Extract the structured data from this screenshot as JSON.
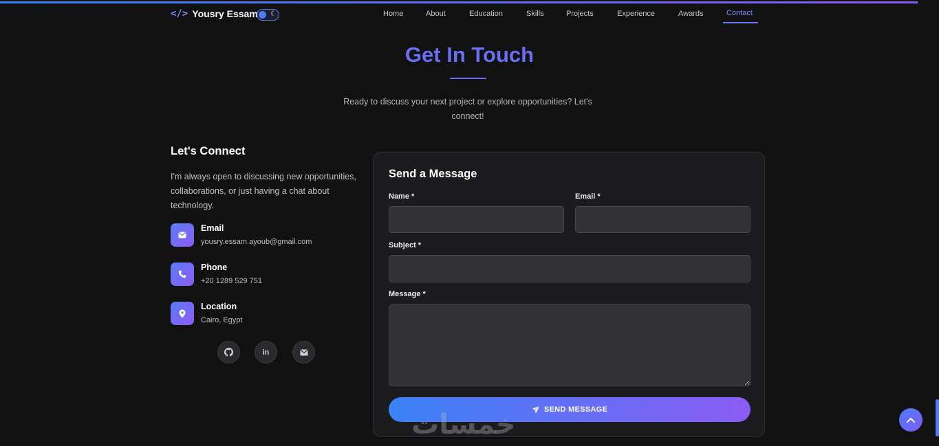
{
  "nav": {
    "brand_code": "</>",
    "brand_name": "Yousry Essam",
    "theme_toggle_moon": "☾",
    "links": [
      "Home",
      "About",
      "Education",
      "Skills",
      "Projects",
      "Experience",
      "Awards",
      "Contact"
    ],
    "active": "Contact"
  },
  "hero": {
    "title": "Get In Touch",
    "subtitle": "Ready to discuss your next project or explore opportunities? Let's connect!"
  },
  "connect": {
    "title": "Let's Connect",
    "text": "I'm always open to discussing new opportunities, collaborations, or just having a chat about technology.",
    "items": [
      {
        "label": "Email",
        "value": "yousry.essam.ayoub@gmail.com",
        "icon": "envelope-icon"
      },
      {
        "label": "Phone",
        "value": "+20 1289 529 751",
        "icon": "phone-icon"
      },
      {
        "label": "Location",
        "value": "Cairo, Egypt",
        "icon": "map-pin-icon"
      }
    ],
    "socials": [
      {
        "icon": "github-icon"
      },
      {
        "icon": "linkedin-icon",
        "glyph": "in"
      },
      {
        "icon": "envelope-icon"
      }
    ]
  },
  "form": {
    "title": "Send a Message",
    "name_label": "Name *",
    "email_label": "Email *",
    "subject_label": "Subject *",
    "message_label": "Message *",
    "name_value": "",
    "email_value": "",
    "subject_value": "",
    "message_value": "",
    "send_label": "SEND MESSAGE"
  },
  "watermark": "خمسات",
  "colors": {
    "accent": "#6a6ef2",
    "gradient_start": "#3b82f6",
    "gradient_end": "#8b5cf6",
    "background": "#111112",
    "card": "#1c1c1e"
  }
}
